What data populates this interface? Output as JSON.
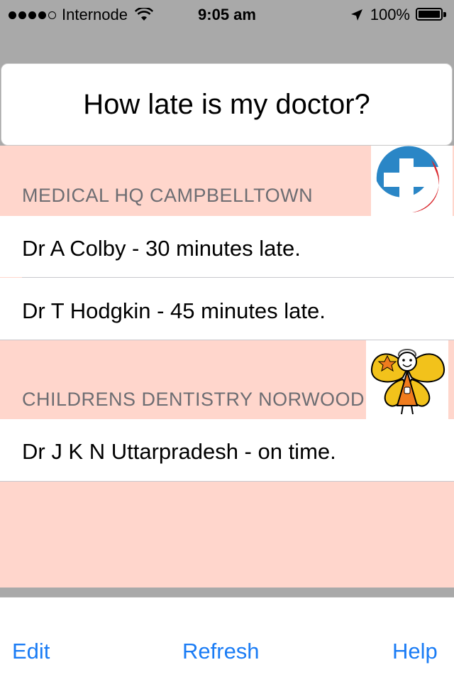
{
  "status_bar": {
    "carrier": "Internode",
    "time": "9:05 am",
    "battery": "100%",
    "signal_bars_filled": 4,
    "signal_bars_total": 5
  },
  "header": {
    "title": "How late is my doctor?"
  },
  "sections": [
    {
      "name": "MEDICAL HQ CAMPBELLTOWN",
      "logo_icon": "medical-cross-logo",
      "rows": [
        "Dr A Colby - 30 minutes late.",
        "Dr T Hodgkin - 45 minutes late."
      ]
    },
    {
      "name": "CHILDRENS DENTISTRY NORWOOD",
      "logo_icon": "tooth-fairy-logo",
      "rows": [
        "Dr J K N Uttarpradesh - on time."
      ]
    }
  ],
  "toolbar": {
    "edit": "Edit",
    "refresh": "Refresh",
    "help": "Help"
  },
  "colors": {
    "section_bg": "#ffd6cc",
    "accent": "#1a7cf5",
    "background": "#a9a9a9"
  }
}
